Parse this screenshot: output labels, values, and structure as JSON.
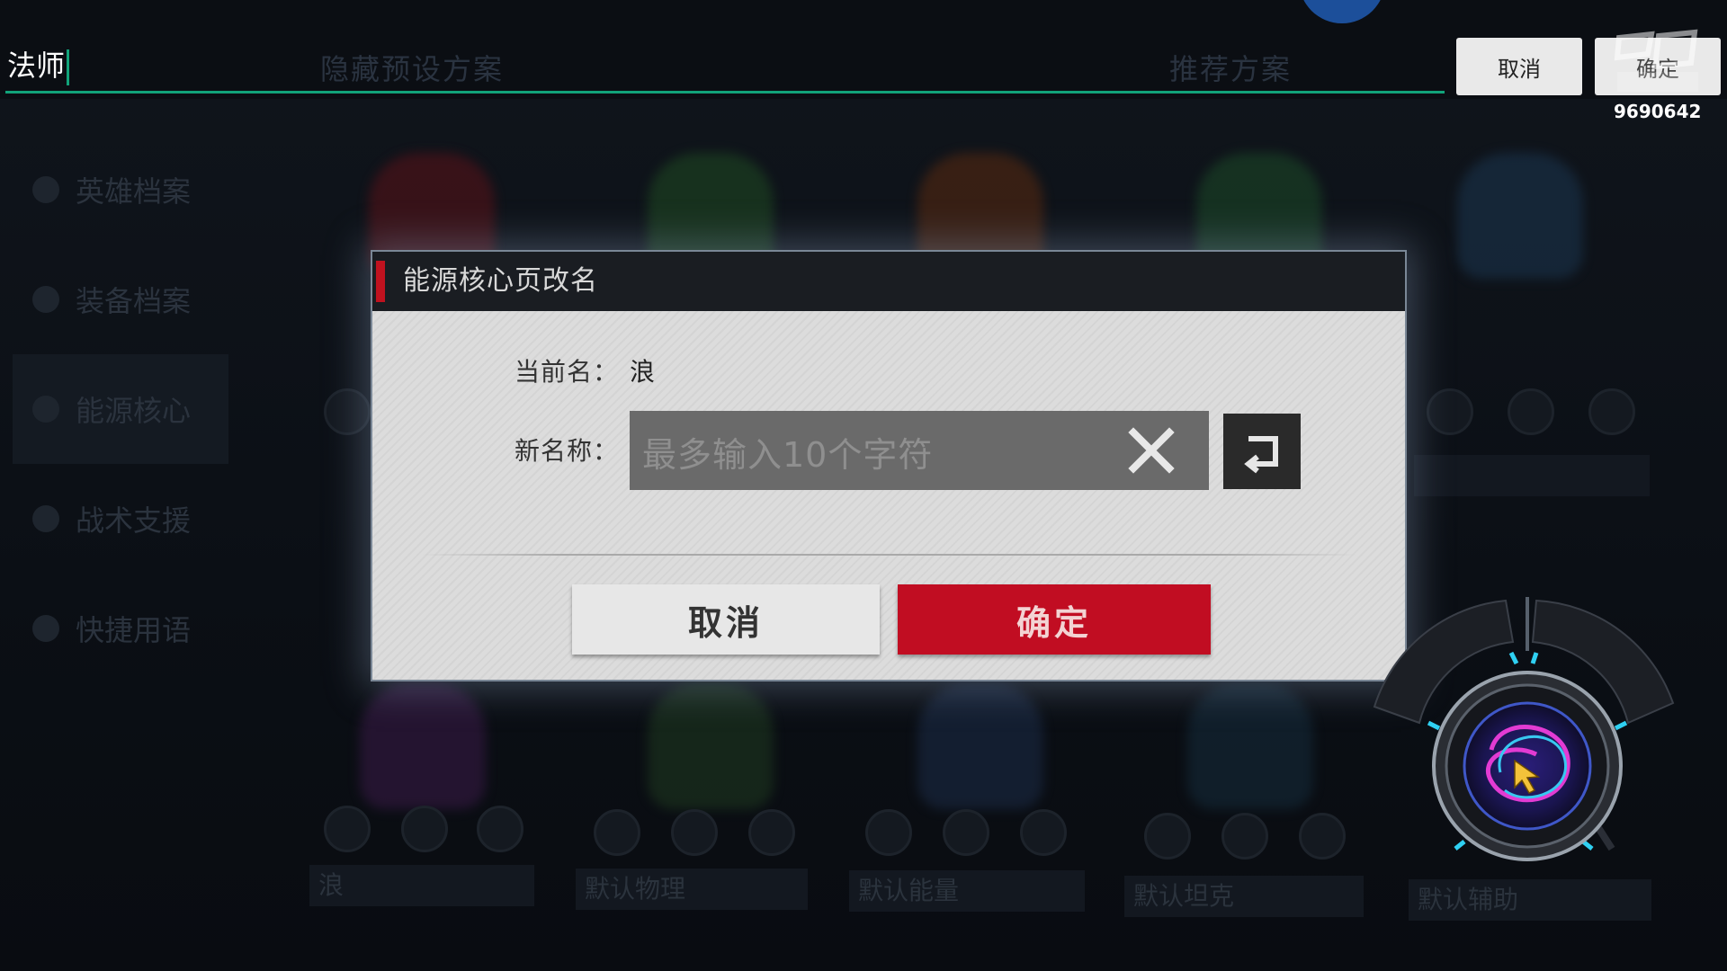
{
  "top_input": {
    "value": "法师"
  },
  "top_buttons": {
    "cancel_label": "取消",
    "confirm_label": "确定"
  },
  "watermark": {
    "number": "9690642"
  },
  "background": {
    "tabs": [
      "隐藏预设方案",
      "推荐方案"
    ],
    "sidebar": [
      "英雄档案",
      "装备档案",
      "能源核心",
      "战术支援",
      "快捷用语"
    ],
    "preset_names": [
      "浪",
      "默认物理",
      "默认能量",
      "默认坦克",
      "默认辅助"
    ]
  },
  "dialog": {
    "title": "能源核心页改名",
    "current_label": "当前名：",
    "current_value": "浪",
    "new_label": "新名称：",
    "input_placeholder": "最多输入10个字符",
    "cancel_label": "取消",
    "confirm_label": "确定"
  },
  "colors": {
    "accent_red": "#c10d22",
    "input_underline": "#12a37a",
    "dialog_bg": "#dcdcdc",
    "header_bg": "#1a1d22"
  }
}
